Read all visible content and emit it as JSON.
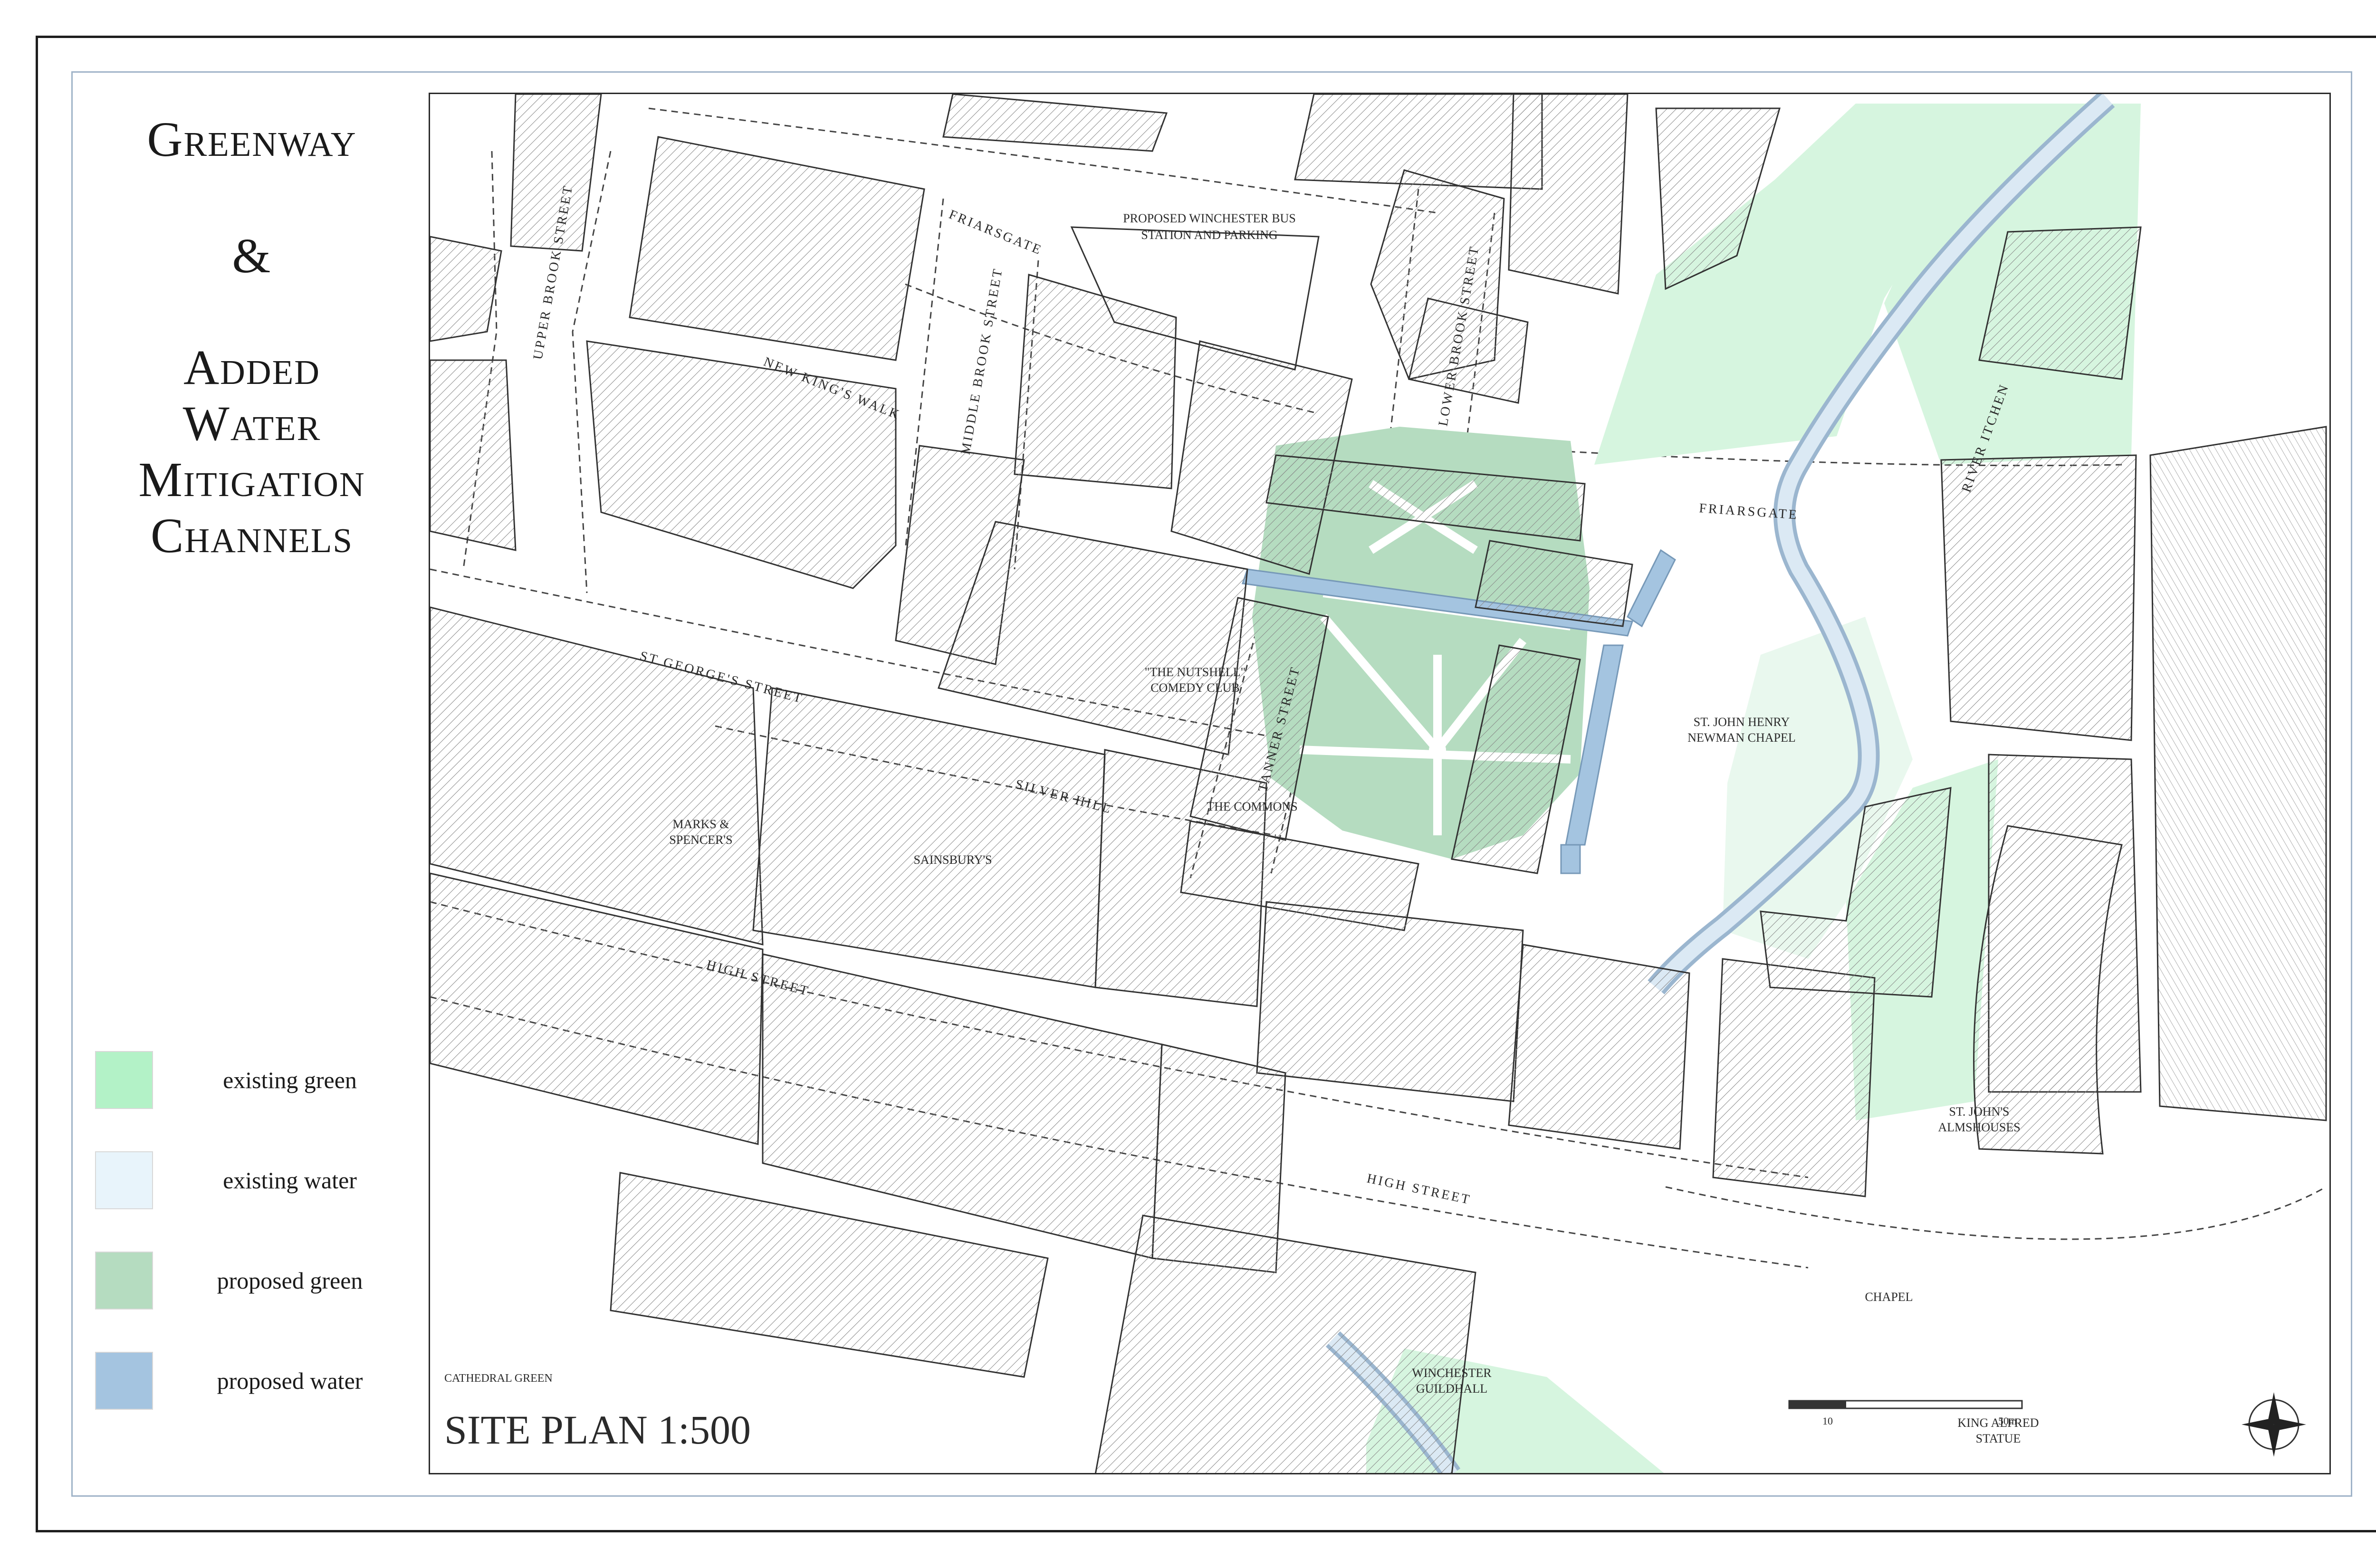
{
  "title": {
    "line1": "Greenway",
    "line2": "&",
    "line3": "Added",
    "line4": "Water",
    "line5": "Mitigation",
    "line6": "Channels"
  },
  "legend": [
    {
      "label": "existing green",
      "color": "#b3f2c7"
    },
    {
      "label": "existing water",
      "color": "#e8f4fb"
    },
    {
      "label": "proposed green",
      "color": "#b5dcc0"
    },
    {
      "label": "proposed water",
      "color": "#a4c4e0"
    }
  ],
  "map": {
    "site_plan": "SITE PLAN 1:500",
    "cathedral_green": "CATHEDRAL GREEN",
    "scale_bar": {
      "a": "10",
      "b": "50m"
    },
    "streets": {
      "upper_brook": "UPPER BROOK STREET",
      "middle_brook": "MIDDLE BROOK STREET",
      "lower_brook": "LOWER BROOK STREET",
      "friarsgate_1": "FRIARSGATE",
      "friarsgate_2": "FRIARSGATE",
      "new_kings_walk": "NEW KING'S WALK",
      "st_georges": "ST GEORGE'S STREET",
      "silver_hill": "SILVER HILL",
      "tanner": "TANNER STREET",
      "high_street_1": "HIGH STREET",
      "high_street_2": "HIGH STREET",
      "river_itchen": "RIVER ITCHEN"
    },
    "places": {
      "bus_station_1": "PROPOSED WINCHESTER BUS",
      "bus_station_2": "STATION AND PARKING",
      "nutshell_1": "\"THE NUTSHELL\"",
      "nutshell_2": "COMEDY CLUB",
      "newman_1": "ST. JOHN HENRY",
      "newman_2": "NEWMAN CHAPEL",
      "commons": "THE COMMONS",
      "ms_1": "MARKS &",
      "ms_2": "SPENCER'S",
      "sainsburys": "SAINSBURY'S",
      "almshouses_1": "ST. JOHN'S",
      "almshouses_2": "ALMSHOUSES",
      "chapel": "CHAPEL",
      "guildhall_1": "WINCHESTER",
      "guildhall_2": "GUILDHALL",
      "alfred_1": "KING ALFRED",
      "alfred_2": "STATUE"
    }
  }
}
